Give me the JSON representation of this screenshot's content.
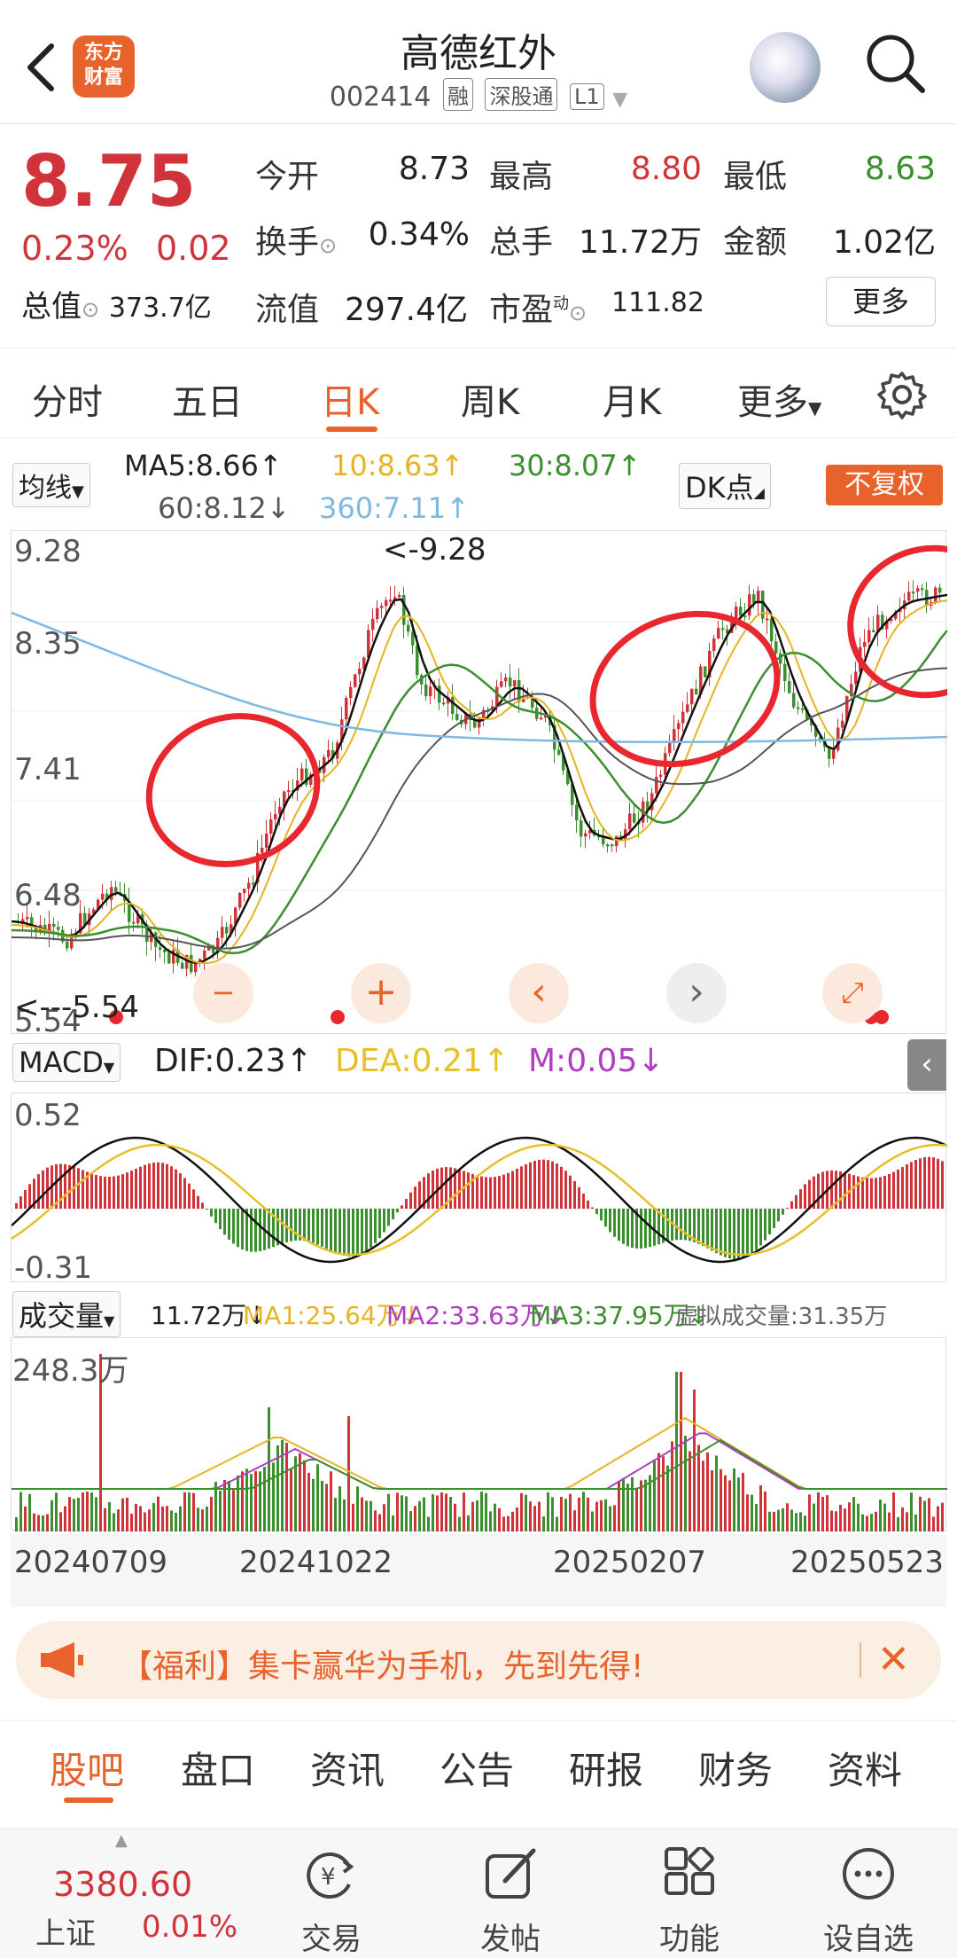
{
  "header": {
    "title": "高德红外",
    "code": "002414",
    "tags": [
      "融",
      "深股通",
      "L1"
    ],
    "logo_text": "东方财富"
  },
  "quote": {
    "price": "8.75",
    "change_pct": "0.23%",
    "change": "0.02",
    "market_cap_label": "总值",
    "market_cap": "373.7亿",
    "stats": [
      {
        "label": "今开",
        "value": "8.73",
        "color": "neutral"
      },
      {
        "label": "最高",
        "value": "8.80",
        "color": "red"
      },
      {
        "label": "最低",
        "value": "8.63",
        "color": "green"
      },
      {
        "label": "换手",
        "value": "0.34%",
        "color": "neutral"
      },
      {
        "label": "总手",
        "value": "11.72万",
        "color": "neutral"
      },
      {
        "label": "金额",
        "value": "1.02亿",
        "color": "neutral"
      },
      {
        "label": "流值",
        "value": "297.4亿",
        "color": "neutral"
      },
      {
        "label": "市盈",
        "value": "111.82",
        "color": "neutral",
        "superscript": "动"
      }
    ],
    "more_button": "更多"
  },
  "tabs": [
    "分时",
    "五日",
    "日K",
    "周K",
    "月K",
    "更多"
  ],
  "active_tab": "日K",
  "ma_legend": {
    "selector": "均线",
    "ma5": "MA5:8.66↑",
    "ma10": "10:8.63↑",
    "ma30": "30:8.07↑",
    "ma60": "60:8.12↓",
    "ma360": "360:7.11↑",
    "dk": "DK点",
    "fuquan": "不复权"
  },
  "kline": {
    "y_labels": [
      "9.28",
      "8.35",
      "7.41",
      "6.48",
      "5.54"
    ],
    "max_label": "<-9.28",
    "min_label": "<---5.54"
  },
  "macd": {
    "selector": "MACD",
    "dif": "DIF:0.23↑",
    "dea": "DEA:0.21↑",
    "m": "M:0.05↓",
    "y_top": "0.52",
    "y_bottom": "-0.31"
  },
  "volume": {
    "selector": "成交量",
    "vol": "11.72万↓",
    "ma1": "MA1:25.64万↓",
    "ma2": "MA2:33.63万↓",
    "ma3": "MA3:37.95万↓",
    "virtual": "虚拟成交量:31.35万",
    "y_top": "248.3万"
  },
  "dates": [
    "20240709",
    "20241022",
    "20250207",
    "20250523"
  ],
  "banner": {
    "text": "【福利】集卡赢华为手机，先到先得!"
  },
  "section_tabs": [
    "股吧",
    "盘口",
    "资讯",
    "公告",
    "研报",
    "财务",
    "资料"
  ],
  "active_section": "股吧",
  "bottom_nav": {
    "index_value": "3380.60",
    "index_name": "上证",
    "index_pct": "0.01%",
    "items": [
      "交易",
      "发帖",
      "功能",
      "设自选"
    ]
  },
  "colors": {
    "accent": "#e8622c",
    "up": "#d0343a",
    "down": "#3c8f2f",
    "ma10": "#e6b422",
    "ma60": "#555555",
    "ma360": "#7fb8e0",
    "dea": "#e6c02a",
    "m": "#b03fc0"
  }
}
